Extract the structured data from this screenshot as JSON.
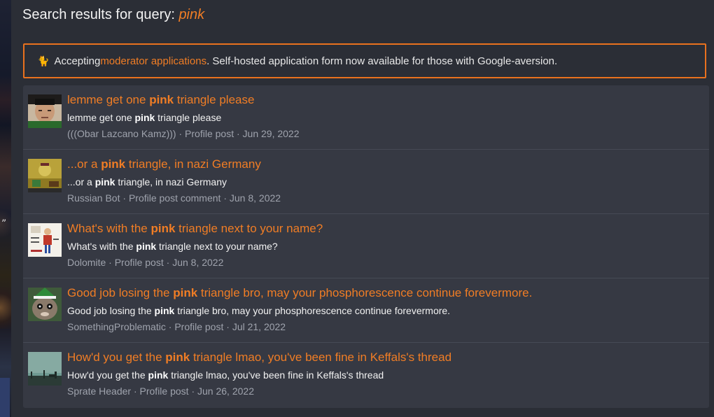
{
  "page": {
    "title_prefix": "Search results for query: ",
    "query": "pink"
  },
  "notice": {
    "icon": "cat-icon",
    "text_before": "Accepting ",
    "link_text": "moderator applications",
    "text_after": ". Self-hosted application form now available for those with Google-aversion."
  },
  "results": [
    {
      "title_before": "lemme get one ",
      "title_hl": "pink",
      "title_after": " triangle please",
      "snippet_before": "lemme get one ",
      "snippet_hl": "pink",
      "snippet_after": " triangle please",
      "author": "(((Obar Lazcano Kamz)))",
      "sep1": " · ",
      "type": "Profile post",
      "sep2": " · ",
      "date": "Jun 29, 2022"
    },
    {
      "title_before": "...or a ",
      "title_hl": "pink",
      "title_after": " triangle, in nazi Germany",
      "snippet_before": "...or a ",
      "snippet_hl": "pink",
      "snippet_after": " triangle, in nazi Germany",
      "author": "Russian Bot",
      "sep1": " · ",
      "type": "Profile post comment",
      "sep2": " · ",
      "date": "Jun 8, 2022"
    },
    {
      "title_before": "What's with the ",
      "title_hl": "pink",
      "title_after": " triangle next to your name?",
      "snippet_before": "What's with the ",
      "snippet_hl": "pink",
      "snippet_after": " triangle next to your name?",
      "author": "Dolomite",
      "sep1": " · ",
      "type": "Profile post",
      "sep2": " · ",
      "date": "Jun 8, 2022"
    },
    {
      "title_before": "Good job losing the ",
      "title_hl": "pink",
      "title_after": " triangle bro, may your phosphorescence continue forevermore.",
      "snippet_before": "Good job losing the ",
      "snippet_hl": "pink",
      "snippet_after": " triangle bro, may your phosphorescence continue forevermore.",
      "author": "SomethingProblematic",
      "sep1": " · ",
      "type": "Profile post",
      "sep2": " · ",
      "date": "Jul 21, 2022"
    },
    {
      "title_before": "How'd you get the ",
      "title_hl": "pink",
      "title_after": " triangle lmao, you've been fine in Keffals's thread",
      "snippet_before": "How'd you get the ",
      "snippet_hl": "pink",
      "snippet_after": " triangle lmao, you've been fine in Keffals's thread",
      "author": "Sprate Header",
      "sep1": " · ",
      "type": "Profile post",
      "sep2": " · ",
      "date": "Jun 26, 2022"
    }
  ],
  "colors": {
    "accent": "#f07d25",
    "background": "#2b2e36",
    "panel": "#363943",
    "meta": "#9fa3ad"
  }
}
